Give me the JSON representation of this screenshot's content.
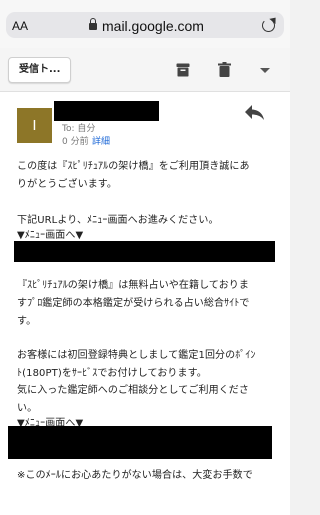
{
  "browser": {
    "text_size_label": "AA",
    "url": "mail.google.com"
  },
  "toolbar": {
    "back_label": "受信ト..."
  },
  "message": {
    "avatar_letter": "I",
    "to_label": "To: 自分",
    "time": "0 分前",
    "details_link": "詳細",
    "body_lines": [
      "この度は『ｽﾋﾟﾘﾁｭｱﾙの架け橋』をご利用頂き誠にあ",
      "りがとうございます。",
      "下記URLより、ﾒﾆｭｰ画面へお進みください。",
      "▼ﾒﾆｭｰ画面へ▼",
      "『ｽﾋﾟﾘﾁｭｱﾙの架け橋』は無料占いや在籍しておりま",
      "すﾌﾟﾛ鑑定師の本格鑑定が受けられる占い総合ｻｲﾄで",
      "す。",
      "お客様には初回登録特典としまして鑑定1回分のﾎﾟｲﾝ",
      "ﾄ(180PT)をｻｰﾋﾞｽでお付けしております。",
      "気に入った鑑定師へのご相談分としてご利用くださ",
      "い。",
      "▼ﾒﾆｭｰ画面へ▼",
      "※このﾒｰﾙにお心あたりがない場合は、大変お手数で"
    ]
  },
  "colors": {
    "avatar": "#8d7628",
    "link": "#1a66d6"
  }
}
